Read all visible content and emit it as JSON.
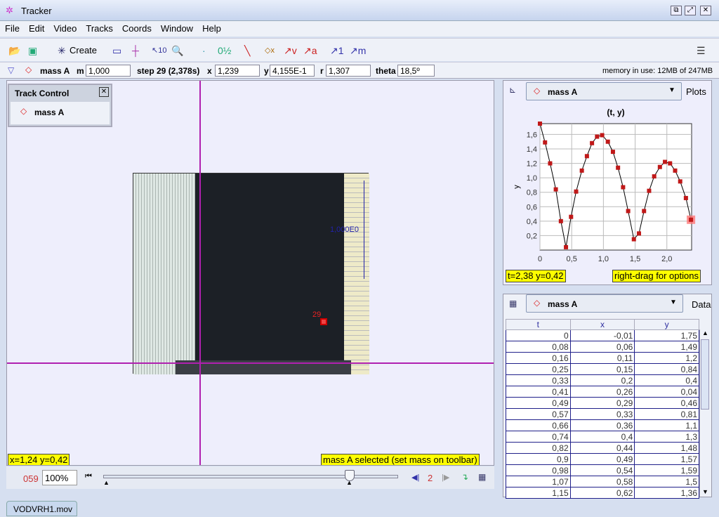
{
  "window": {
    "title": "Tracker"
  },
  "menu": [
    "File",
    "Edit",
    "Video",
    "Tracks",
    "Coords",
    "Window",
    "Help"
  ],
  "toolbar": {
    "create_label": "Create"
  },
  "trackbar": {
    "track_name": "mass A",
    "m_label": "m",
    "m_value": "1,000",
    "step_label": "step 29 (2,378s)",
    "x_label": "x",
    "x_value": "1,239",
    "y_label": "y",
    "y_value": "4,155E-1",
    "r_label": "r",
    "r_value": "1,307",
    "theta_label": "theta",
    "theta_value": "18,5º",
    "memory": "memory in use: 12MB of 247MB"
  },
  "track_control": {
    "title": "Track Control",
    "item": "mass A"
  },
  "video": {
    "scale_label": "1,000E0",
    "point_label": "29",
    "coord_readout": "x=1,24  y=0,42",
    "status": "mass A selected (set mass on toolbar)"
  },
  "player": {
    "frame": "059",
    "zoom": "100%",
    "step_size": "2"
  },
  "tab": {
    "label": "VODVRH1.mov"
  },
  "plot_panel": {
    "track": "mass A",
    "button": "Plots",
    "readout": "t=2,38  y=0,42",
    "hint": "right-drag for options"
  },
  "data_panel": {
    "track": "mass A",
    "button": "Data",
    "columns": [
      "t",
      "x",
      "y"
    ],
    "rows": [
      [
        "0",
        "-0,01",
        "1,75"
      ],
      [
        "0,08",
        "0,06",
        "1,49"
      ],
      [
        "0,16",
        "0,11",
        "1,2"
      ],
      [
        "0,25",
        "0,15",
        "0,84"
      ],
      [
        "0,33",
        "0,2",
        "0,4"
      ],
      [
        "0,41",
        "0,26",
        "0,04"
      ],
      [
        "0,49",
        "0,29",
        "0,46"
      ],
      [
        "0,57",
        "0,33",
        "0,81"
      ],
      [
        "0,66",
        "0,36",
        "1,1"
      ],
      [
        "0,74",
        "0,4",
        "1,3"
      ],
      [
        "0,82",
        "0,44",
        "1,48"
      ],
      [
        "0,9",
        "0,49",
        "1,57"
      ],
      [
        "0,98",
        "0,54",
        "1,59"
      ],
      [
        "1,07",
        "0,58",
        "1,5"
      ],
      [
        "1,15",
        "0,62",
        "1,36"
      ]
    ]
  },
  "colors": {
    "crosshair": "#b020b0",
    "point": "#cc1111",
    "highlight": "#ffff00"
  },
  "chart_data": {
    "type": "line",
    "title": "(t, y)",
    "xlabel": "",
    "ylabel": "y",
    "xlim": [
      0,
      2.39
    ],
    "ylim": [
      0,
      1.75
    ],
    "grid": true,
    "xticks": [
      "0",
      "0,5",
      "1,0",
      "1,5",
      "2,0"
    ],
    "yticks": [
      "0,2",
      "0,4",
      "0,6",
      "0,8",
      "1,0",
      "1,2",
      "1,4",
      "1,6"
    ],
    "x": [
      0,
      0.08,
      0.16,
      0.25,
      0.33,
      0.41,
      0.49,
      0.57,
      0.66,
      0.74,
      0.82,
      0.9,
      0.98,
      1.07,
      1.15,
      1.23,
      1.31,
      1.39,
      1.48,
      1.56,
      1.64,
      1.72,
      1.8,
      1.89,
      1.97,
      2.05,
      2.13,
      2.21,
      2.3,
      2.38
    ],
    "y": [
      1.75,
      1.49,
      1.2,
      0.84,
      0.4,
      0.04,
      0.46,
      0.81,
      1.1,
      1.3,
      1.48,
      1.57,
      1.59,
      1.5,
      1.36,
      1.14,
      0.87,
      0.54,
      0.15,
      0.23,
      0.54,
      0.82,
      1.02,
      1.15,
      1.22,
      1.2,
      1.1,
      0.95,
      0.72,
      0.42
    ],
    "selected_index": 29
  }
}
